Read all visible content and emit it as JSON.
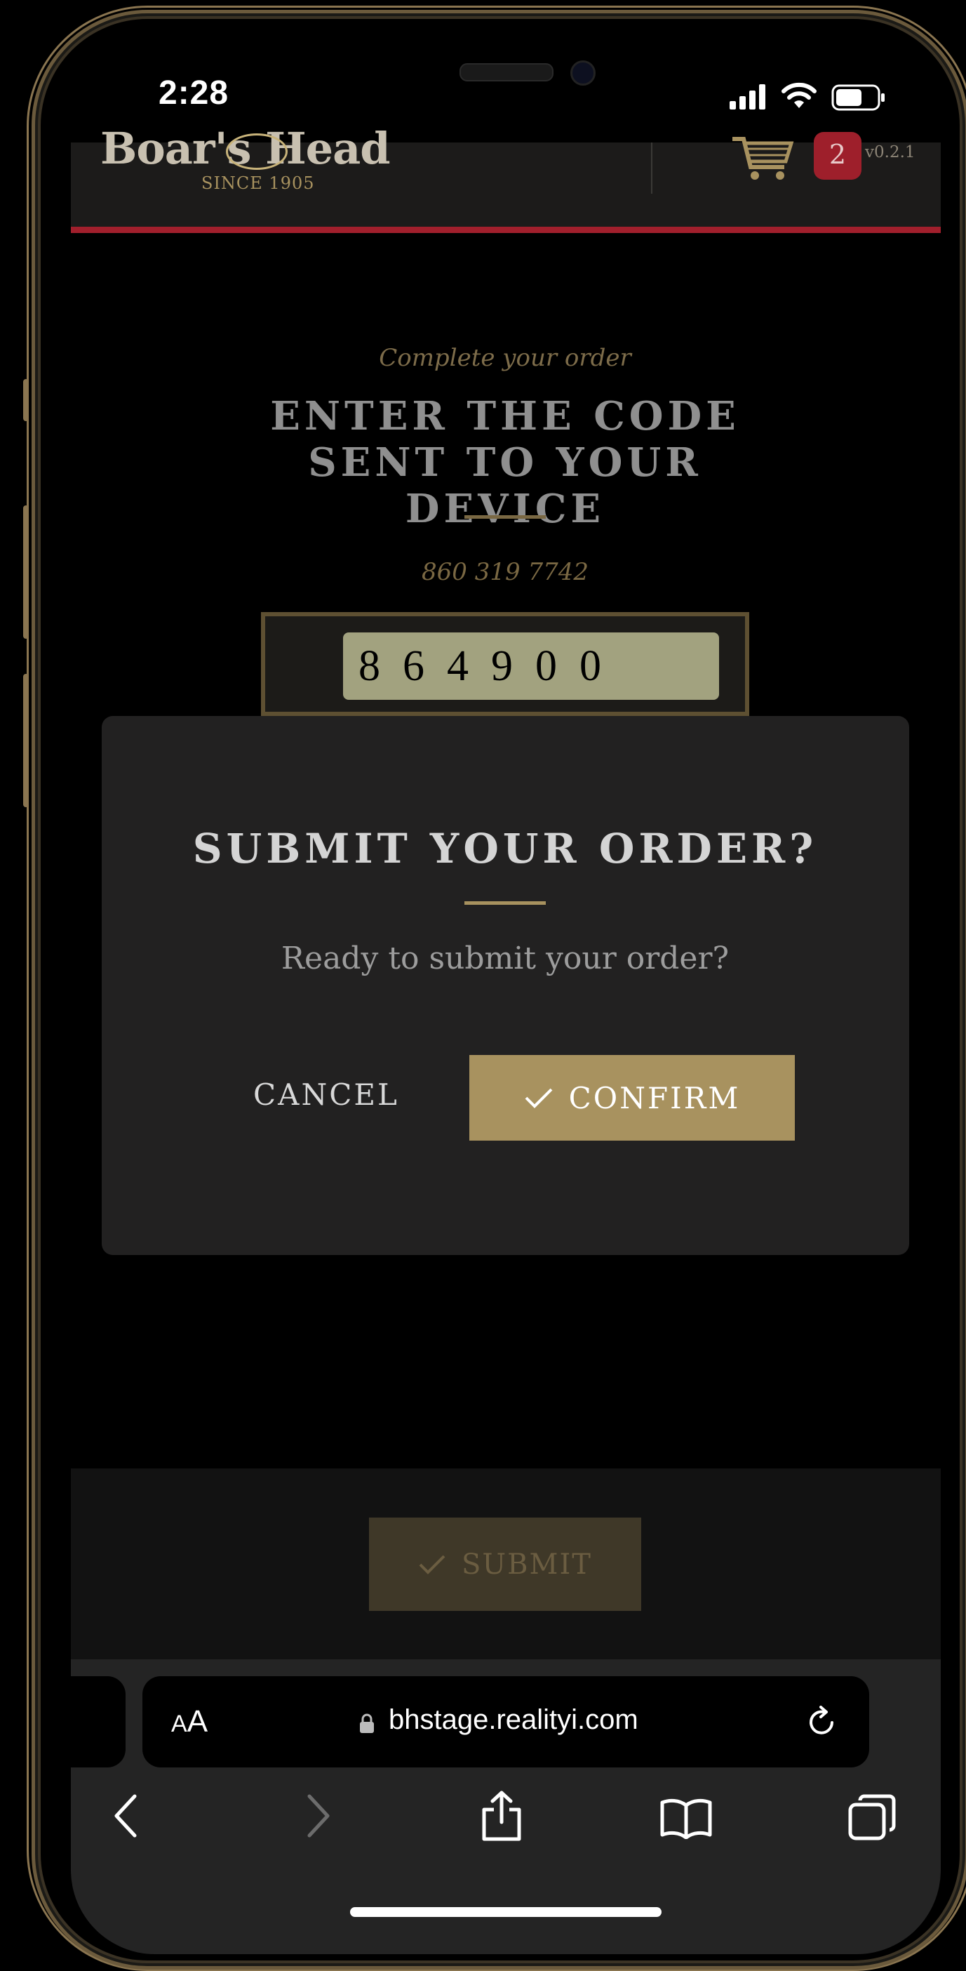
{
  "status_bar": {
    "time": "2:28"
  },
  "header": {
    "logo_text": "Boar's Head",
    "logo_tagline": "SINCE 1905",
    "cart_count": "2",
    "version": "v0.2.1"
  },
  "verification": {
    "eyebrow": "Complete your order",
    "title": "ENTER THE CODE SENT TO YOUR DEVICE",
    "phone_number": "860 319 7742",
    "code_value": "864900"
  },
  "footer": {
    "submit_label": "SUBMIT"
  },
  "modal": {
    "title": "SUBMIT YOUR ORDER?",
    "body": "Ready to submit your order?",
    "cancel_label": "CANCEL",
    "confirm_label": "CONFIRM"
  },
  "browser": {
    "aa_small": "A",
    "aa_big": "A",
    "url": "bhstage.realityi.com"
  },
  "colors": {
    "accent_gold": "#a8925f",
    "brand_red": "#a11f2c"
  }
}
